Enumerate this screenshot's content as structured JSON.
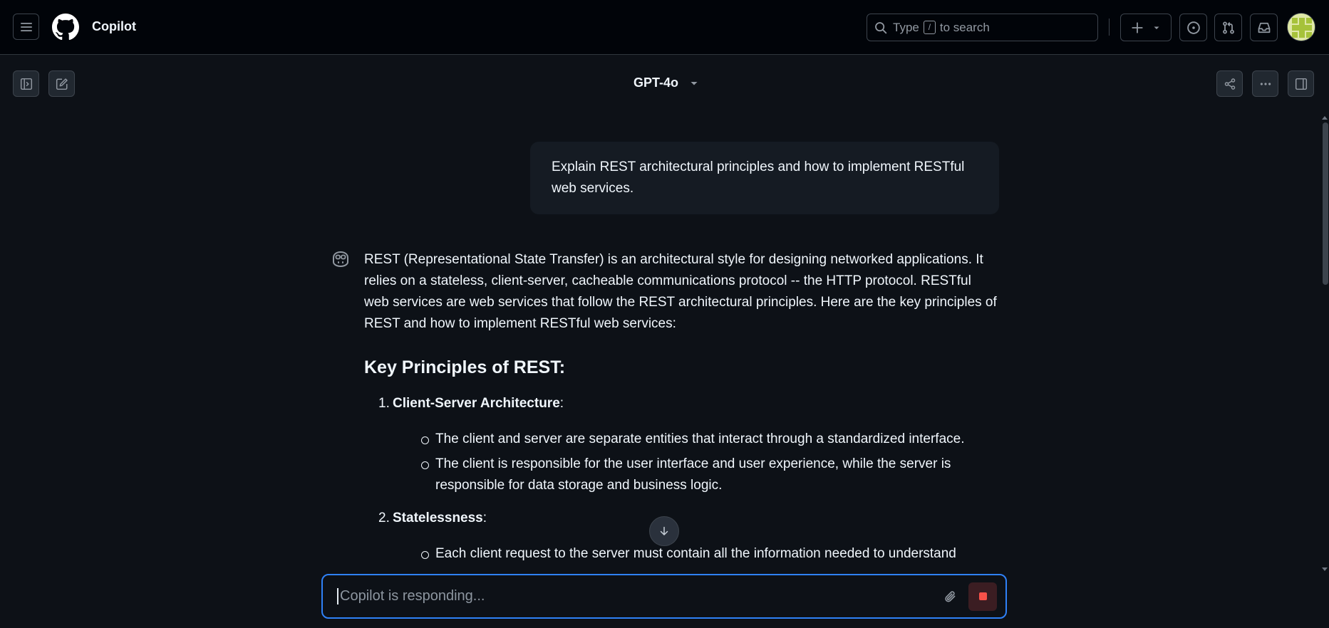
{
  "header": {
    "app_title": "Copilot",
    "search": {
      "prefix": "Type",
      "key": "/",
      "suffix": "to search"
    },
    "icons": {
      "menu": "hamburger-icon",
      "logo": "github-logo-icon",
      "search": "search-icon",
      "create": "plus-icon",
      "create_dropdown": "triangle-down-icon",
      "issues": "issue-opened-icon",
      "pull_requests": "git-pull-request-icon",
      "inbox": "inbox-icon"
    }
  },
  "toolbar": {
    "model": "GPT-4o",
    "icons": {
      "sidebar_toggle": "sidebar-expand-icon",
      "new_chat": "pencil-square-icon",
      "share": "share-icon",
      "more": "kebab-horizontal-icon",
      "panel_toggle": "sidebar-collapse-icon"
    }
  },
  "conversation": {
    "user_message": "Explain REST architectural principles and how to implement RESTful web services.",
    "assistant": {
      "intro": "REST (Representational State Transfer) is an architectural style for designing networked applications. It relies on a stateless, client-server, cacheable communications protocol -- the HTTP protocol. RESTful web services are web services that follow the REST architectural principles. Here are the key principles of REST and how to implement RESTful web services:",
      "heading": "Key Principles of REST:",
      "principles": [
        {
          "number": "1.",
          "title": "Client-Server Architecture",
          "suffix": ":",
          "bullets": [
            "The client and server are separate entities that interact through a standardized interface.",
            "The client is responsible for the user interface and user experience, while the server is responsible for data storage and business logic."
          ]
        },
        {
          "number": "2.",
          "title": "Statelessness",
          "suffix": ":",
          "bullets": [
            "Each client request to the server must contain all the information needed to understand"
          ]
        }
      ]
    }
  },
  "composer": {
    "placeholder": "Copilot is responding...",
    "icons": {
      "attach": "paperclip-icon",
      "stop": "stop-icon"
    }
  },
  "colors": {
    "background": "#0d1117",
    "header_background": "#010409",
    "bubble": "#151b23",
    "accent": "#2f81f7",
    "stop": "#f85149"
  }
}
